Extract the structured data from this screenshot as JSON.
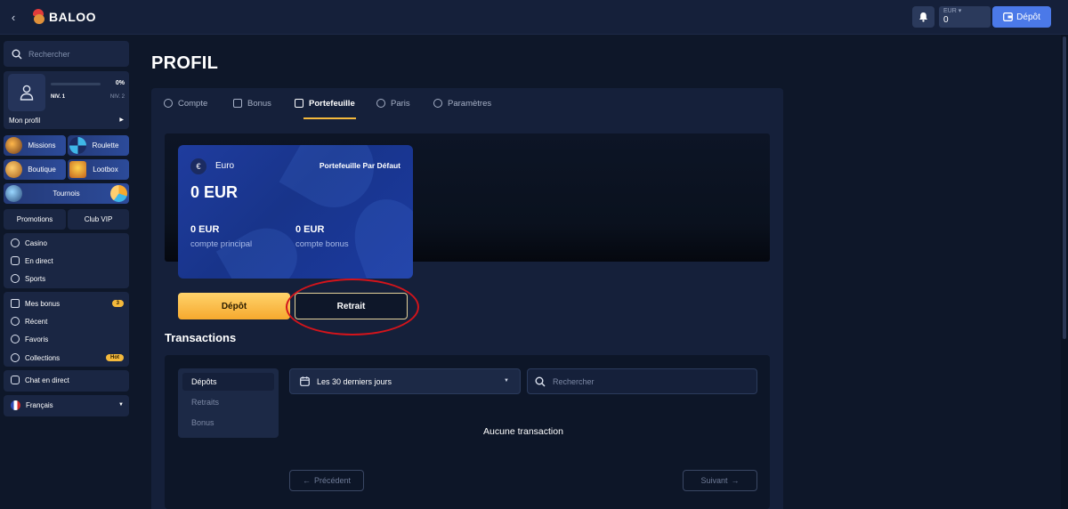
{
  "header": {
    "logo_text": "BALOO",
    "balance_currency": "EUR ▾",
    "balance_value": "0",
    "deposit_label": "Dépôt"
  },
  "sidebar": {
    "search_placeholder": "Rechercher",
    "profile": {
      "xp_percent": "0%",
      "xp_fraction": 0,
      "level_current": "NIV. 1",
      "level_next": "NIV. 2",
      "link_label": "Mon profil"
    },
    "tiles": {
      "missions": "Missions",
      "roulette": "Roulette",
      "boutique": "Boutique",
      "lootbox": "Lootbox",
      "tournois": "Tournois"
    },
    "promotions": "Promotions",
    "club_vip": "Club VIP",
    "nav": {
      "casino": "Casino",
      "en_direct": "En direct",
      "sports": "Sports"
    },
    "personal": {
      "mes_bonus": "Mes bonus",
      "mes_bonus_badge": "3",
      "recent": "Récent",
      "favoris": "Favoris",
      "collections": "Collections",
      "collections_badge": "Hot"
    },
    "chat": "Chat en direct",
    "language": "Français"
  },
  "page": {
    "title": "PROFIL",
    "tabs": {
      "compte": "Compte",
      "bonus": "Bonus",
      "portefeuille": "Portefeuille",
      "paris": "Paris",
      "parametres": "Paramètres"
    }
  },
  "wallet": {
    "currency_symbol": "€",
    "currency_name": "Euro",
    "default_label": "Portefeuille Par Défaut",
    "balance": "0 EUR",
    "main_value": "0 EUR",
    "main_label": "compte principal",
    "bonus_value": "0 EUR",
    "bonus_label": "compte bonus"
  },
  "actions": {
    "deposit": "Dépôt",
    "withdraw": "Retrait"
  },
  "transactions": {
    "title": "Transactions",
    "filters": {
      "depots": "Dépôts",
      "retraits": "Retraits",
      "bonus": "Bonus"
    },
    "period": "Les 30 derniers jours",
    "search_placeholder": "Rechercher",
    "empty": "Aucune transaction",
    "prev": "Précédent",
    "next": "Suivant"
  },
  "colors": {
    "accent_yellow": "#f4b93c",
    "brand_blue": "#4b79e8",
    "highlight_ring": "#d3141b"
  }
}
